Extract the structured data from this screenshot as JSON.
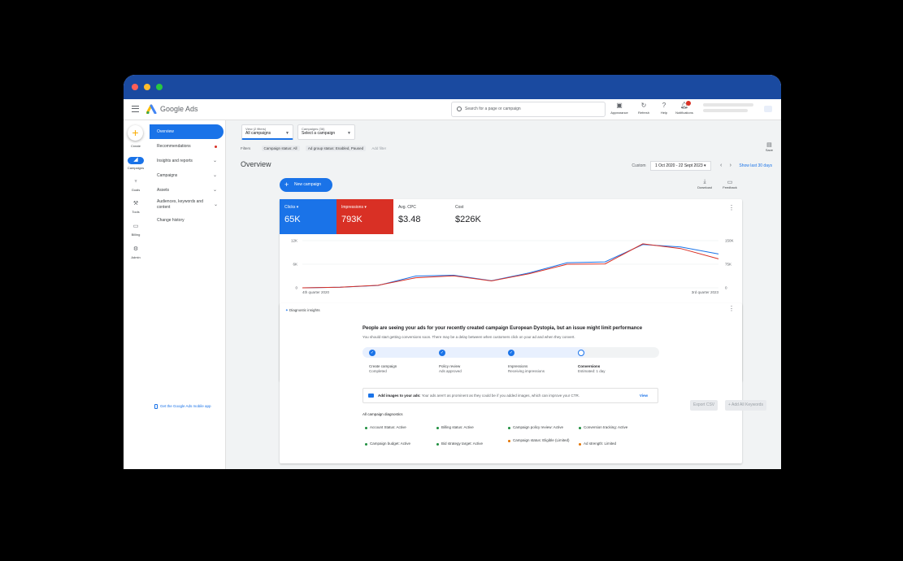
{
  "app": {
    "brand": "Google Ads",
    "search_placeholder": "Search for a page or campaign"
  },
  "toolbar": {
    "appearance": "Appearance",
    "refresh": "Refresh",
    "help": "Help",
    "notifications": "Notifications",
    "notification_count": "1"
  },
  "rail": {
    "create": "Create",
    "campaigns": "Campaigns",
    "goals": "Goals",
    "tools": "Tools",
    "billing": "Billing",
    "admin": "Admin"
  },
  "sidenav": {
    "items": [
      {
        "label": "Overview"
      },
      {
        "label": "Recommendations"
      },
      {
        "label": "Insights and reports"
      },
      {
        "label": "Campaigns"
      },
      {
        "label": "Assets"
      },
      {
        "label": "Audiences, keywords and content"
      },
      {
        "label": "Change history"
      }
    ],
    "mobile_app": "Get the Google Ads mobile app"
  },
  "filters": {
    "view_small": "View (2 filters)",
    "view_value": "All campaigns",
    "campaigns_small": "Campaigns (36)",
    "campaigns_value": "Select a campaign",
    "label": "Filters",
    "chip1": "Campaign status: All",
    "chip2": "Ad group status: Enabled, Paused",
    "add": "Add filter",
    "save": "Save"
  },
  "overview": {
    "title": "Overview",
    "date_label": "Custom",
    "date_range": "1 Oct 2020 - 22 Sept 2023",
    "show_last": "Show last 30 days",
    "new_campaign": "New campaign",
    "download": "Download",
    "feedback": "Feedback"
  },
  "metrics": [
    {
      "label": "Clicks",
      "value": "65K"
    },
    {
      "label": "Impressions",
      "value": "793K"
    },
    {
      "label": "Avg. CPC",
      "value": "$3.48"
    },
    {
      "label": "Cost",
      "value": "$226K"
    }
  ],
  "colors": {
    "blue": "#1a73e8",
    "red": "#d93025",
    "titlebar": "#1a4aa0"
  },
  "chart_data": {
    "type": "line",
    "x": [
      "4th quarter 2020",
      "",
      "",
      "",
      "",
      "",
      "",
      "",
      "",
      "",
      "",
      "3rd quarter 2023"
    ],
    "x_first_label": "4th quarter 2020",
    "x_last_label": "3rd quarter 2023",
    "left_axis": {
      "ticks": [
        "12K",
        "6K",
        "0"
      ],
      "ylim": [
        0,
        12000
      ]
    },
    "right_axis": {
      "ticks": [
        "150K",
        "75K",
        "0"
      ],
      "ylim": [
        0,
        150000
      ]
    },
    "series": [
      {
        "name": "Clicks",
        "color": "#1a73e8",
        "axis": "left",
        "values": [
          0,
          150,
          600,
          3000,
          3200,
          1800,
          3800,
          6400,
          6600,
          11000,
          10400,
          8600
        ]
      },
      {
        "name": "Impressions",
        "color": "#d93025",
        "axis": "right",
        "values": [
          0,
          2000,
          8000,
          32000,
          38000,
          22000,
          45000,
          75000,
          76000,
          140000,
          125000,
          92000
        ]
      }
    ]
  },
  "diagnostics": {
    "header": "Diagnostic insights",
    "title": "People are seeing your ads for your recently created campaign European Dystopia, but an issue might limit performance",
    "subtitle": "You should start getting conversions soon. There may be a delay between when customers click on your ad and when they convert.",
    "steps": [
      {
        "title": "Create campaign",
        "status": "Completed"
      },
      {
        "title": "Policy review",
        "status": "Ads approved"
      },
      {
        "title": "Impressions",
        "status": "Receiving impressions"
      },
      {
        "title": "Conversions",
        "status": "Estimated: 1 day"
      }
    ],
    "add_images_bold": "Add images to your ads:",
    "add_images_text": "Your ads aren't as prominent as they could be if you added images, which can improve your CTR.",
    "view": "View",
    "all_label": "All campaign diagnostics",
    "items": [
      "Account Status: Active",
      "Billing status: Active",
      "Campaign policy review: Active",
      "Conversion tracking: Active",
      "Campaign budget: Active",
      "Bid strategy target: Active",
      "Campaign status: Eligible (Limited)",
      "Ad strength: Limited"
    ]
  },
  "actions": {
    "export_csv": "Export CSV",
    "add_keywords": "+ Add All Keywords"
  }
}
